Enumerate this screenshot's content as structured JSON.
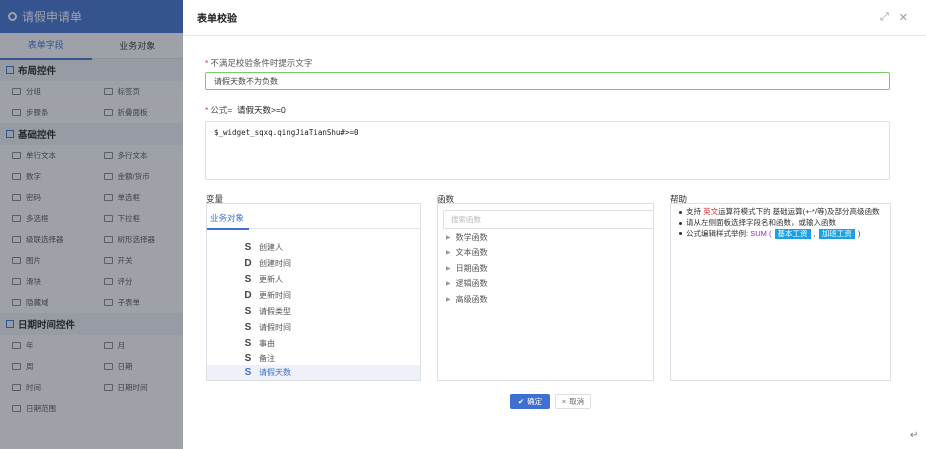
{
  "left": {
    "title": "请假申请单",
    "tabs": [
      "表单字段",
      "业务对象"
    ],
    "groups": [
      {
        "title": "布局控件",
        "items": [
          "分组",
          "标签页",
          "步骤条",
          "折叠面板"
        ]
      },
      {
        "title": "基础控件",
        "items": [
          "单行文本",
          "多行文本",
          "数字",
          "金额/货币",
          "密码",
          "单选框",
          "多选框",
          "下拉框",
          "级联选择器",
          "树形选择器",
          "图片",
          "开关",
          "滑块",
          "评分",
          "隐藏域",
          "子表单"
        ]
      },
      {
        "title": "日期时间控件",
        "items": [
          "年",
          "月",
          "周",
          "日期",
          "时间",
          "日期时间",
          "日期范围"
        ]
      }
    ]
  },
  "modal": {
    "title": "表单校验",
    "tip_label": "不满足校验条件时提示文字",
    "tip_value": "请假天数不为负数",
    "formula_label": "公式=",
    "formula_readable": "请假天数>=0",
    "formula_value": "$_widget_sqxq.qingJiaTianShu#>=0",
    "variables": {
      "title": "变量",
      "tab": "业务对象",
      "items": [
        {
          "type": "S",
          "label": "创建人"
        },
        {
          "type": "D",
          "label": "创建时间"
        },
        {
          "type": "S",
          "label": "更新人"
        },
        {
          "type": "D",
          "label": "更新时间"
        },
        {
          "type": "S",
          "label": "请假类型"
        },
        {
          "type": "S",
          "label": "请假时间"
        },
        {
          "type": "S",
          "label": "事由"
        },
        {
          "type": "S",
          "label": "备注"
        },
        {
          "type": "S",
          "label": "请假天数"
        }
      ]
    },
    "functions": {
      "title": "函数",
      "search_placeholder": "搜索函数",
      "items": [
        "数学函数",
        "文本函数",
        "日期函数",
        "逻辑函数",
        "高级函数"
      ]
    },
    "help": {
      "title": "帮助",
      "line1_prefix": "支持",
      "line1_highlight": "英文",
      "line1_suffix": "运算符模式下的 基础运算(+-*/等)及部分高级函数",
      "line2": "请从左侧面板选择字段名和函数，或输入函数",
      "line3_prefix": "公式编辑样式举例:",
      "line3_fn": "SUM",
      "line3_tag1": "基本工资",
      "line3_tag2": "加班工资"
    },
    "ok_label": "确定",
    "cancel_label": "取消"
  },
  "colors": {
    "primary": "#3f6fd1",
    "valid_border": "#7ecb69",
    "required": "#e0393e",
    "tag": "#1aa0e6"
  }
}
